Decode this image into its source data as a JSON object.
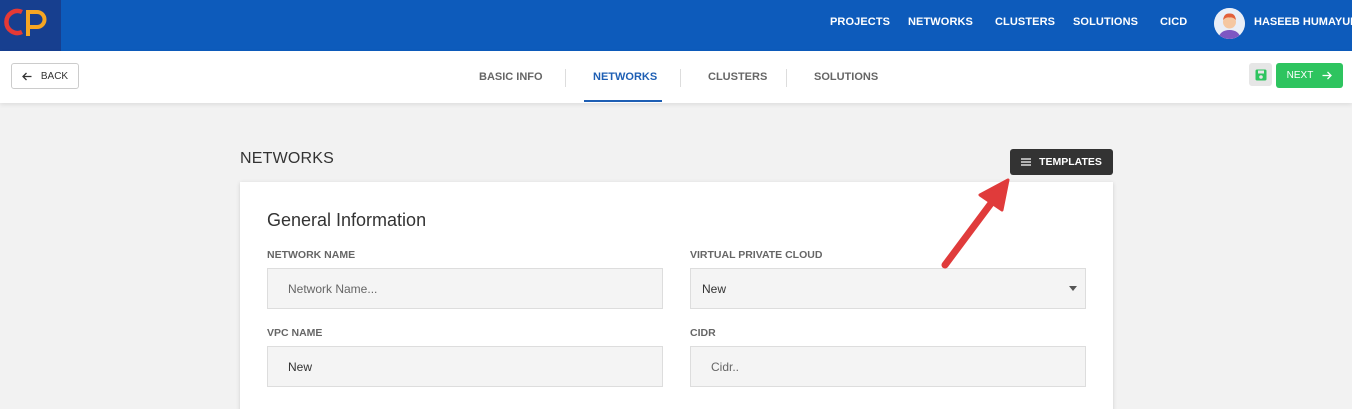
{
  "app": {
    "logo_text": "CP"
  },
  "topnav": {
    "items": [
      "PROJECTS",
      "NETWORKS",
      "CLUSTERS",
      "SOLUTIONS",
      "CICD"
    ],
    "user_name": "HASEEB HUMAYUN"
  },
  "subbar": {
    "back_label": "BACK",
    "tabs": [
      "BASIC INFO",
      "NETWORKS",
      "CLUSTERS",
      "SOLUTIONS"
    ],
    "active_tab": "NETWORKS",
    "next_label": "NEXT"
  },
  "main": {
    "section_title": "NETWORKS",
    "templates_label": "TEMPLATES",
    "card_title": "General Information",
    "fields": {
      "network_name": {
        "label": "NETWORK NAME",
        "placeholder": "Network Name..."
      },
      "vpc": {
        "label": "VIRTUAL PRIVATE CLOUD",
        "value": "New"
      },
      "vpc_name": {
        "label": "VPC NAME",
        "value": "New"
      },
      "cidr": {
        "label": "CIDR",
        "placeholder": "Cidr.."
      }
    }
  },
  "colors": {
    "topbar": "#0d5bbb",
    "accent": "#1e5fb4",
    "next": "#2ec45f",
    "templates": "#333333",
    "annotation_arrow": "#e03b3b"
  },
  "icons": {
    "back": "arrow-left-icon",
    "save": "floppy-disk-icon",
    "next": "arrow-right-icon",
    "templates": "menu-icon",
    "dropdown": "caret-down-icon"
  }
}
